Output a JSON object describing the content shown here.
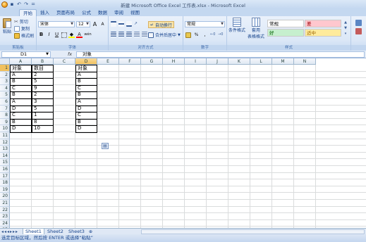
{
  "window": {
    "title": "新建 Microsoft Office Excel 工作表.xlsx - Microsoft Excel"
  },
  "quick_access": {
    "icons": [
      "save-icon",
      "undo-icon",
      "redo-icon"
    ],
    "undo_glyph": "↶",
    "redo_glyph": "↷",
    "more_glyph": "="
  },
  "tabs": [
    "开始",
    "插入",
    "页面布局",
    "公式",
    "数据",
    "审阅",
    "视图"
  ],
  "ribbon": {
    "clipboard": {
      "label": "剪贴板",
      "paste": "粘贴",
      "cut": "剪切",
      "copy": "复制",
      "format_painter": "格式刷"
    },
    "font": {
      "label": "字体",
      "name": "宋体",
      "size": "12",
      "grow": "A",
      "shrink": "A",
      "bold": "B",
      "italic": "I",
      "underline": "U",
      "font_color_letter": "A",
      "phonetic": "wén"
    },
    "alignment": {
      "label": "对齐方式",
      "wrap_text": "自动换行",
      "merge_center": "合并后居中"
    },
    "number": {
      "label": "数字",
      "format": "常规",
      "percent": "%",
      "comma": ","
    },
    "styles": {
      "label": "样式",
      "conditional": "条件格式",
      "table_format_1": "套用",
      "table_format_2": "表格格式",
      "cell_normal": "常规",
      "cell_bad": "差",
      "cell_good": "好",
      "cell_neutral": "适中"
    },
    "colors": {
      "bad_bg": "#ffc7ce",
      "bad_fg": "#9c0006",
      "good_bg": "#c6efce",
      "good_fg": "#006100",
      "neutral_bg": "#ffeb9c",
      "neutral_fg": "#9c6500"
    }
  },
  "formula_bar": {
    "name_box": "D1",
    "fx": "fx",
    "formula": "对象"
  },
  "columns": [
    "A",
    "B",
    "C",
    "D",
    "E",
    "F",
    "G",
    "H",
    "I",
    "J",
    "K",
    "L",
    "M",
    "N"
  ],
  "rows": [
    "1",
    "2",
    "3",
    "4",
    "5",
    "6",
    "7",
    "8",
    "9",
    "10",
    "11",
    "12",
    "13",
    "14",
    "15",
    "16",
    "17",
    "18",
    "19",
    "20",
    "21",
    "22",
    "23",
    "24",
    "25"
  ],
  "sheet": {
    "table1_header": [
      "对象",
      "数目"
    ],
    "table1": [
      [
        "A",
        "2"
      ],
      [
        "B",
        "5"
      ],
      [
        "C",
        "9"
      ],
      [
        "B",
        "2"
      ],
      [
        "A",
        "3"
      ],
      [
        "D",
        "5"
      ],
      [
        "C",
        "1"
      ],
      [
        "B",
        "8"
      ],
      [
        "D",
        "10"
      ]
    ],
    "table2_header": "对象",
    "table2": [
      "A",
      "B",
      "C",
      "B",
      "A",
      "D",
      "C",
      "B",
      "D"
    ]
  },
  "sheet_tabs": [
    "Sheet1",
    "Sheet2",
    "Sheet3"
  ],
  "status": "选定目标区域，然后按 ENTER 或选择“粘贴”"
}
